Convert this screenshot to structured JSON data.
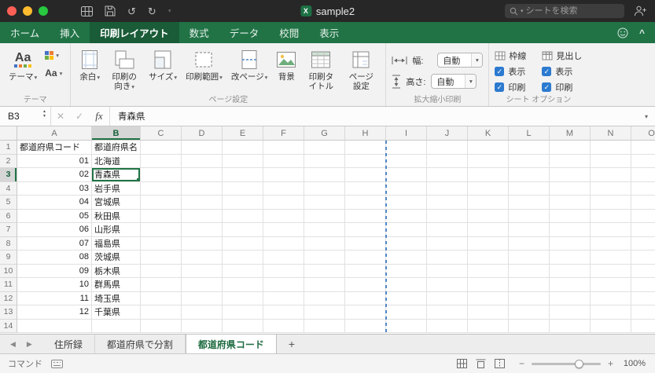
{
  "titlebar": {
    "title": "sample2",
    "search_placeholder": "シートを検索"
  },
  "ribbon_tabs": [
    {
      "label": "ホーム",
      "active": false
    },
    {
      "label": "挿入",
      "active": false
    },
    {
      "label": "印刷レイアウト",
      "active": true
    },
    {
      "label": "数式",
      "active": false
    },
    {
      "label": "データ",
      "active": false
    },
    {
      "label": "校閲",
      "active": false
    },
    {
      "label": "表示",
      "active": false
    }
  ],
  "ribbon": {
    "groups": {
      "themes": "テーマ",
      "page_setup": "ページ設定",
      "scale": "拡大縮小印刷",
      "sheet_options": "シート オプション"
    },
    "themes_label": "テーマ",
    "theme_icon_text": "Aa",
    "theme_fonts_text": "Aa",
    "margins_label": "余白",
    "orientation_label": "印刷の向き",
    "size_label": "サイズ",
    "print_area_label": "印刷範囲",
    "breaks_label": "改ページ",
    "background_label": "背景",
    "print_titles_label": "印刷タイトル",
    "page_setup_label": "ページ設定",
    "width_label": "幅:",
    "height_label": "高さ:",
    "width_value": "自動",
    "height_value": "自動",
    "gridlines_label": "枠線",
    "headings_label": "見出し",
    "show_label": "表示",
    "print_label": "印刷",
    "gridlines_show_checked": true,
    "gridlines_print_checked": true,
    "headings_show_checked": true,
    "headings_print_checked": true
  },
  "formula_bar": {
    "cell_ref": "B3",
    "fx_label": "fx",
    "value": "青森県"
  },
  "sheet": {
    "columns": [
      "A",
      "B",
      "C",
      "D",
      "E",
      "F",
      "G",
      "H",
      "I",
      "J",
      "K",
      "L",
      "M",
      "N",
      "O"
    ],
    "selected_column": "B",
    "selected_row": 3,
    "rows": [
      {
        "n": 1,
        "a": "都道府県コード",
        "b": "都道府県名"
      },
      {
        "n": 2,
        "a": "01",
        "b": "北海道"
      },
      {
        "n": 3,
        "a": "02",
        "b": "青森県"
      },
      {
        "n": 4,
        "a": "03",
        "b": "岩手県"
      },
      {
        "n": 5,
        "a": "04",
        "b": "宮城県"
      },
      {
        "n": 6,
        "a": "05",
        "b": "秋田県"
      },
      {
        "n": 7,
        "a": "06",
        "b": "山形県"
      },
      {
        "n": 8,
        "a": "07",
        "b": "福島県"
      },
      {
        "n": 9,
        "a": "08",
        "b": "茨城県"
      },
      {
        "n": 10,
        "a": "09",
        "b": "栃木県"
      },
      {
        "n": 11,
        "a": "10",
        "b": "群馬県"
      },
      {
        "n": 12,
        "a": "11",
        "b": "埼玉県"
      },
      {
        "n": 13,
        "a": "12",
        "b": "千葉県"
      },
      {
        "n": 14,
        "a": "",
        "b": ""
      }
    ]
  },
  "sheet_tabs": {
    "tabs": [
      {
        "label": "住所録",
        "active": false
      },
      {
        "label": "都道府県で分割",
        "active": false
      },
      {
        "label": "都道府県コード",
        "active": true
      }
    ],
    "add_label": "+"
  },
  "status_bar": {
    "mode": "コマンド",
    "zoom_out": "−",
    "zoom_in": "+",
    "zoom_level": "100%"
  },
  "icons": {
    "search": "magnifier",
    "add-people": "person-plus",
    "caret_down": "▾",
    "stepper_up": "▲",
    "stepper_down": "▼",
    "close": "✕",
    "check": "✓",
    "nav_left": "◀",
    "nav_right": "▶",
    "undo": "↺",
    "redo": "↻",
    "collapse": "^"
  },
  "colors": {
    "brand_green": "#217346",
    "active_tab_green": "#1a5c38",
    "selection_green": "#217346",
    "page_break_blue": "#4f86c6",
    "traffic_red": "#ff5f57",
    "traffic_yellow": "#febc2e",
    "traffic_green": "#28c840"
  }
}
